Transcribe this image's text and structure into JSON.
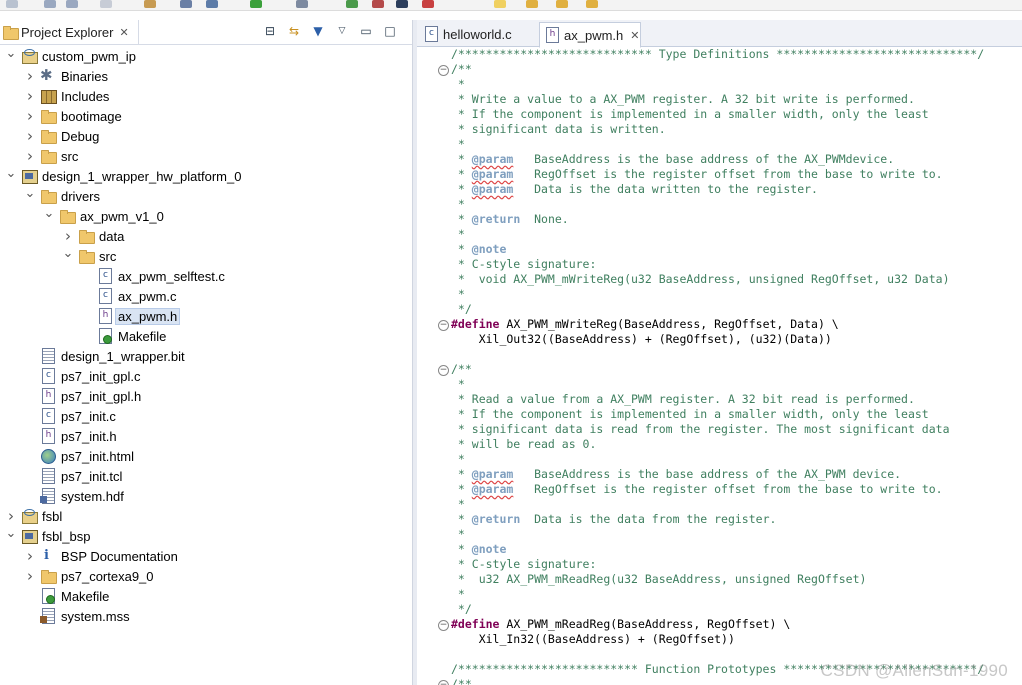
{
  "explorer": {
    "tab_label": "Project Explorer",
    "tree": [
      {
        "label": "custom_pwm_ip",
        "icon": "project-icon",
        "depth": 0,
        "expanded": true
      },
      {
        "label": "Binaries",
        "icon": "binaries-icon",
        "depth": 1,
        "expanded": false
      },
      {
        "label": "Includes",
        "icon": "includes-icon",
        "depth": 1,
        "expanded": false
      },
      {
        "label": "bootimage",
        "icon": "folder-icon",
        "depth": 1,
        "expanded": false
      },
      {
        "label": "Debug",
        "icon": "folder-icon",
        "depth": 1,
        "expanded": false
      },
      {
        "label": "src",
        "icon": "folder-icon",
        "depth": 1,
        "expanded": false
      },
      {
        "label": "design_1_wrapper_hw_platform_0",
        "icon": "hw-platform-icon",
        "depth": 0,
        "expanded": true
      },
      {
        "label": "drivers",
        "icon": "folder-icon",
        "depth": 1,
        "expanded": true
      },
      {
        "label": "ax_pwm_v1_0",
        "icon": "folder-icon",
        "depth": 2,
        "expanded": true
      },
      {
        "label": "data",
        "icon": "folder-icon",
        "depth": 3,
        "expanded": false
      },
      {
        "label": "src",
        "icon": "folder-icon",
        "depth": 3,
        "expanded": true
      },
      {
        "label": "ax_pwm_selftest.c",
        "icon": "c-file-icon",
        "depth": 4
      },
      {
        "label": "ax_pwm.c",
        "icon": "c-file-icon",
        "depth": 4
      },
      {
        "label": "ax_pwm.h",
        "icon": "h-file-icon",
        "depth": 4,
        "selected": true
      },
      {
        "label": "Makefile",
        "icon": "makefile-icon",
        "depth": 4
      },
      {
        "label": "design_1_wrapper.bit",
        "icon": "file-icon",
        "depth": 1
      },
      {
        "label": "ps7_init_gpl.c",
        "icon": "c-file-icon",
        "depth": 1
      },
      {
        "label": "ps7_init_gpl.h",
        "icon": "h-file-icon",
        "depth": 1
      },
      {
        "label": "ps7_init.c",
        "icon": "c-file-icon",
        "depth": 1
      },
      {
        "label": "ps7_init.h",
        "icon": "h-file-icon",
        "depth": 1
      },
      {
        "label": "ps7_init.html",
        "icon": "globe-icon",
        "depth": 1
      },
      {
        "label": "ps7_init.tcl",
        "icon": "file-icon",
        "depth": 1
      },
      {
        "label": "system.hdf",
        "icon": "hdf-file-icon",
        "depth": 1
      },
      {
        "label": "fsbl",
        "icon": "project-icon",
        "depth": 0,
        "expanded": false
      },
      {
        "label": "fsbl_bsp",
        "icon": "bsp-icon",
        "depth": 0,
        "expanded": true
      },
      {
        "label": "BSP Documentation",
        "icon": "info-icon",
        "depth": 1,
        "expanded": false
      },
      {
        "label": "ps7_cortexa9_0",
        "icon": "folder-icon",
        "depth": 1,
        "expanded": false
      },
      {
        "label": "Makefile",
        "icon": "makefile-icon",
        "depth": 1
      },
      {
        "label": "system.mss",
        "icon": "mss-file-icon",
        "depth": 1
      }
    ]
  },
  "editor": {
    "tabs": [
      {
        "label": "helloworld.c",
        "icon": "c-file-icon",
        "active": false
      },
      {
        "label": "ax_pwm.h",
        "icon": "h-file-icon",
        "active": true
      }
    ],
    "lines": [
      {
        "text": "/**************************** Type Definitions *****************************/",
        "kind": "comment"
      },
      {
        "text": "/**",
        "kind": "comment",
        "fold": true
      },
      {
        "text": " *",
        "kind": "comment"
      },
      {
        "text": " * Write a value to a AX_PWM register. A 32 bit write is performed.",
        "kind": "comment"
      },
      {
        "text": " * If the component is implemented in a smaller width, only the least",
        "kind": "comment"
      },
      {
        "text": " * significant data is written.",
        "kind": "comment"
      },
      {
        "text": " *",
        "kind": "comment"
      },
      {
        "text": " * @param   BaseAddress is the base address of the AX_PWMdevice.",
        "kind": "param"
      },
      {
        "text": " * @param   RegOffset is the register offset from the base to write to.",
        "kind": "param"
      },
      {
        "text": " * @param   Data is the data written to the register.",
        "kind": "param"
      },
      {
        "text": " *",
        "kind": "comment"
      },
      {
        "text": " * @return  None.",
        "kind": "comment"
      },
      {
        "text": " *",
        "kind": "comment"
      },
      {
        "text": " * @note",
        "kind": "comment"
      },
      {
        "text": " * C-style signature:",
        "kind": "comment"
      },
      {
        "text": " *  void AX_PWM_mWriteReg(u32 BaseAddress, unsigned RegOffset, u32 Data)",
        "kind": "comment"
      },
      {
        "text": " *",
        "kind": "comment"
      },
      {
        "text": " */",
        "kind": "comment"
      },
      {
        "text": "#define AX_PWM_mWriteReg(BaseAddress, RegOffset, Data) \\",
        "kind": "define",
        "fold": true
      },
      {
        "text": "    Xil_Out32((BaseAddress) + (RegOffset), (u32)(Data))",
        "kind": "code"
      },
      {
        "text": "",
        "kind": "code"
      },
      {
        "text": "/**",
        "kind": "comment",
        "fold": true
      },
      {
        "text": " *",
        "kind": "comment"
      },
      {
        "text": " * Read a value from a AX_PWM register. A 32 bit read is performed.",
        "kind": "comment"
      },
      {
        "text": " * If the component is implemented in a smaller width, only the least",
        "kind": "comment"
      },
      {
        "text": " * significant data is read from the register. The most significant data",
        "kind": "comment"
      },
      {
        "text": " * will be read as 0.",
        "kind": "comment"
      },
      {
        "text": " *",
        "kind": "comment"
      },
      {
        "text": " * @param   BaseAddress is the base address of the AX_PWM device.",
        "kind": "param"
      },
      {
        "text": " * @param   RegOffset is the register offset from the base to write to.",
        "kind": "param"
      },
      {
        "text": " *",
        "kind": "comment"
      },
      {
        "text": " * @return  Data is the data from the register.",
        "kind": "comment"
      },
      {
        "text": " *",
        "kind": "comment"
      },
      {
        "text": " * @note",
        "kind": "comment"
      },
      {
        "text": " * C-style signature:",
        "kind": "comment"
      },
      {
        "text": " *  u32 AX_PWM_mReadReg(u32 BaseAddress, unsigned RegOffset)",
        "kind": "comment"
      },
      {
        "text": " *",
        "kind": "comment"
      },
      {
        "text": " */",
        "kind": "comment"
      },
      {
        "text": "#define AX_PWM_mReadReg(BaseAddress, RegOffset) \\",
        "kind": "define",
        "fold": true
      },
      {
        "text": "    Xil_In32((BaseAddress) + (RegOffset))",
        "kind": "code"
      },
      {
        "text": "",
        "kind": "code"
      },
      {
        "text": "/************************** Function Prototypes ****************************/",
        "kind": "comment"
      },
      {
        "text": "/**",
        "kind": "comment",
        "fold": true
      }
    ]
  },
  "watermark": "CSDN @AllenSun-1990"
}
